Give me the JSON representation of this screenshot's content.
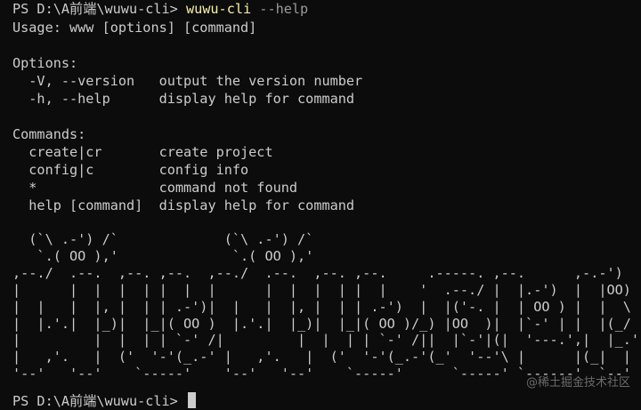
{
  "terminal": {
    "prompt": "PS D:\\A前端\\wuwu-cli>",
    "command_name": "wuwu-cli",
    "command_args": "--help",
    "lines": [
      "Usage: www [options] [command]",
      "",
      "Options:",
      "  -V, --version   output the version number",
      "  -h, --help      display help for command",
      "",
      "Commands:",
      "  create|cr       create project",
      "  config|c        config info",
      "  *               command not found",
      "  help [command]  display help for command"
    ],
    "ascii_art": "  (`\\ .-') /`             (`\\ .-') /`\n   `.( OO ),'              `.( OO ),'\n,--./  .--.  ,--. ,--.  ,--./  .--.  ,--. ,--.     .-----. ,--.      ,-.-')\n|      |  |  |  | |  |  |      |  |  |  | |  |    '  .--./ |  |.-')  |  |OO)\n|  |   |  |, |  | | .-')|  |   |  |, |  | | .-')  |  |('-. |  | OO ) |  |  \\\n|  |.'.|  |_)|  |_|( OO )  |.'.|  |_)|  |_|( OO )/_) |OO  )|  |`-' | |  |(_/\n|         |  |  | | `-' /|         |  |  | | `-' /||  |`-'|(|  '---.',|  |_.'\n|   ,'.   |  ('  '-'(_.-' |   ,'.   |  ('  '-'(_.-'(_'  '--'\\ |      |(_|  |\n'--'   '--'    `-----'    '--'   '--'    `-----'      `-----' `------'  `--'",
    "final_prompt": "PS D:\\A前端\\wuwu-cli>"
  },
  "watermark": "@稀土掘金技术社区",
  "colors": {
    "background": "#0c0c0c",
    "foreground": "#cccccc",
    "command_highlight": "#f9f1a5",
    "argument": "#9a9a9a"
  }
}
